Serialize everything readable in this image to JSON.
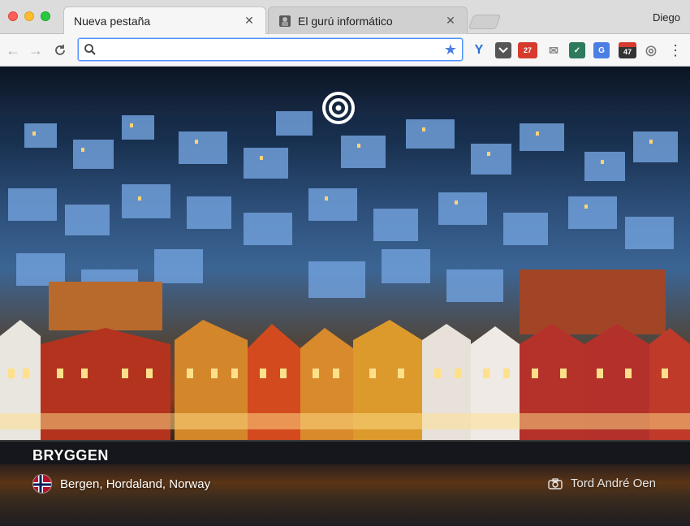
{
  "window": {
    "profile_name": "Diego"
  },
  "tabs": [
    {
      "label": "Nueva pestaña",
      "active": true
    },
    {
      "label": "El gurú informático",
      "active": false
    }
  ],
  "toolbar": {
    "omnibox_value": "",
    "extensions": {
      "calendar_badge": "27",
      "counter_badge": "47"
    }
  },
  "newtab": {
    "place_title": "BRYGGEN",
    "location": "Bergen, Hordaland, Norway",
    "photo_credit": "Tord André Oen"
  },
  "colors": {
    "omnibox_focus": "#4d90fe",
    "bookmark_star": "#4d7fe0"
  }
}
